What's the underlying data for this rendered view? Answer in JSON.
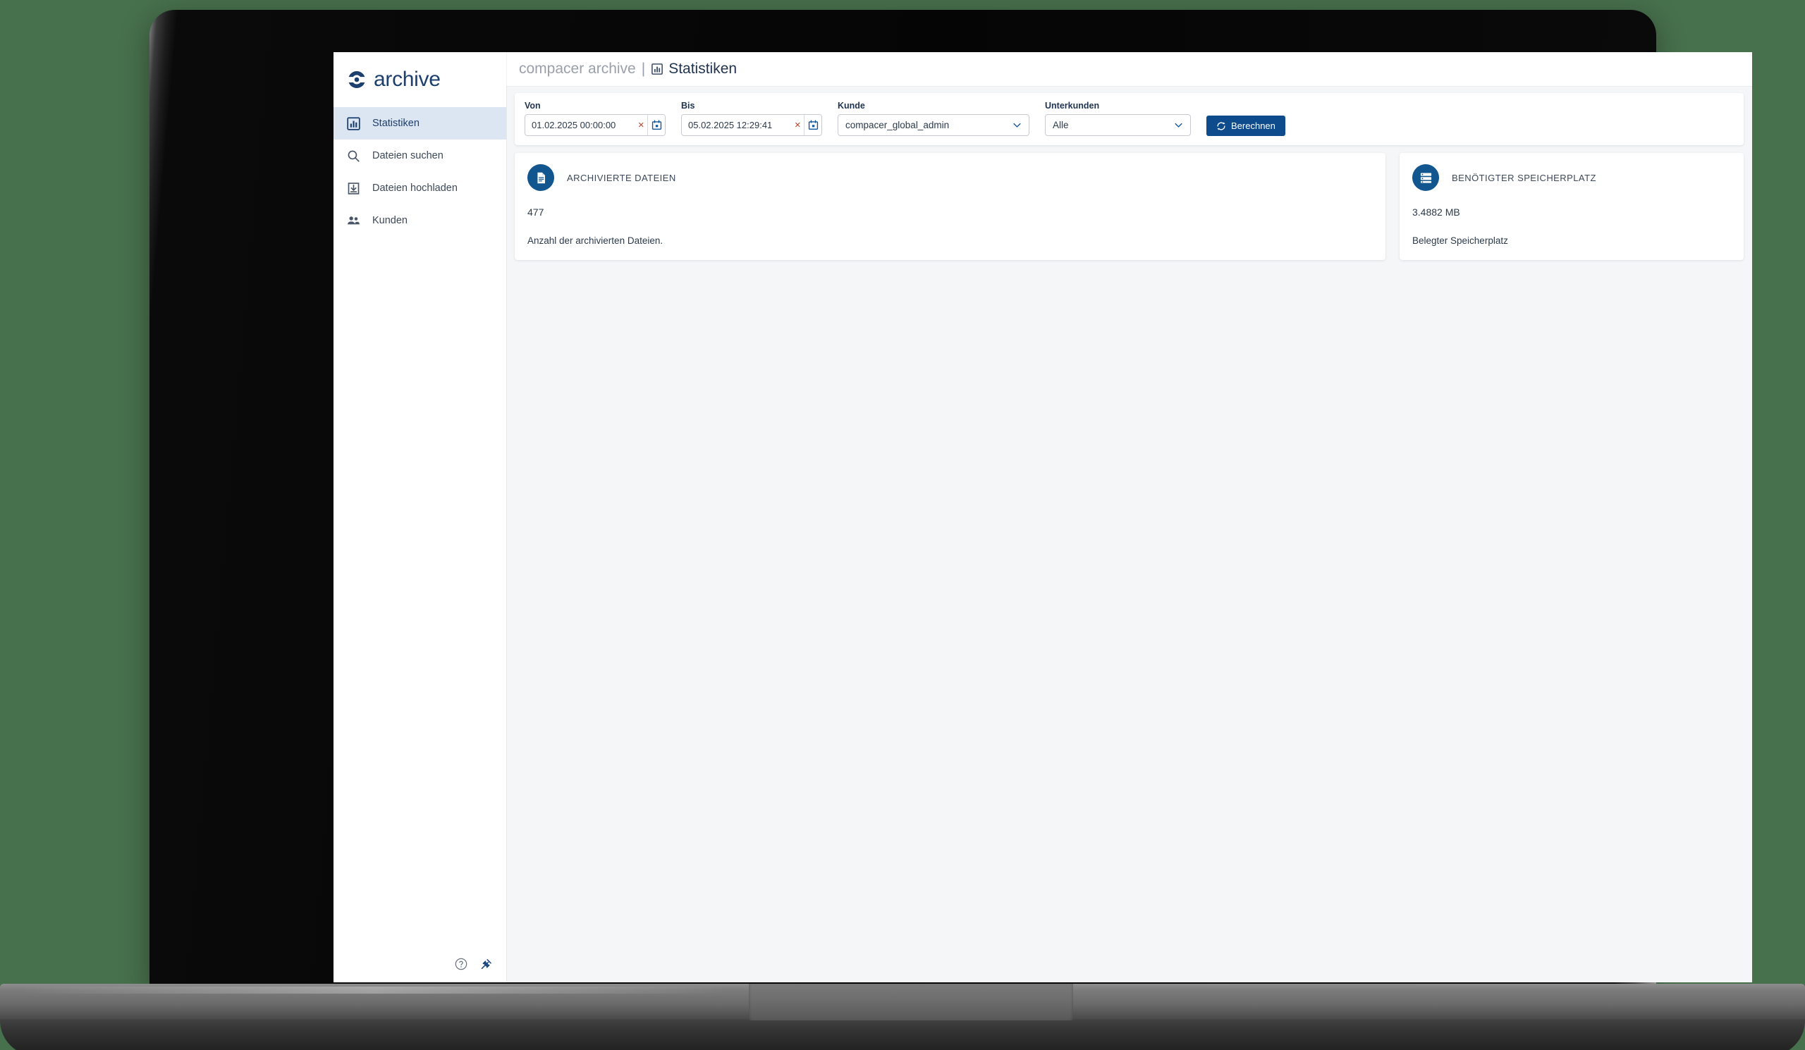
{
  "brand": {
    "name": "archive",
    "logo_icon": "archive-circle-logo"
  },
  "sidebar": {
    "items": [
      {
        "label": "Statistiken",
        "icon": "bar-chart-icon",
        "active": true
      },
      {
        "label": "Dateien suchen",
        "icon": "search-icon",
        "active": false
      },
      {
        "label": "Dateien hochladen",
        "icon": "download-box-icon",
        "active": false
      },
      {
        "label": "Kunden",
        "icon": "people-icon",
        "active": false
      }
    ],
    "footer": {
      "help_icon": "help-circle-icon",
      "pin_icon": "pin-icon"
    }
  },
  "topbar": {
    "app_name": "compacer archive",
    "separator": "|",
    "page_icon": "bar-chart-icon",
    "page_title": "Statistiken"
  },
  "filters": {
    "von": {
      "label": "Von",
      "value": "01.02.2025 00:00:00",
      "placeholder": "TT.MM.JJJJ hh:mm:ss",
      "clear_glyph": "×",
      "calendar_icon": "calendar-icon"
    },
    "bis": {
      "label": "Bis",
      "value": "05.02.2025 12:29:41",
      "placeholder": "TT.MM.JJJJ hh:mm:ss",
      "clear_glyph": "×",
      "calendar_icon": "calendar-icon"
    },
    "kunde": {
      "label": "Kunde",
      "value": "compacer_global_admin",
      "arrow_icon": "chevron-down-icon"
    },
    "unterkunden": {
      "label": "Unterkunden",
      "value": "Alle",
      "arrow_icon": "chevron-down-icon"
    },
    "calculate_button": {
      "label": "Berechnen",
      "icon": "refresh-icon"
    }
  },
  "cards": [
    {
      "title": "ARCHIVIERTE DATEIEN",
      "value": "477",
      "description": "Anzahl der archivierten Dateien.",
      "icon": "document-icon"
    },
    {
      "title": "BENÖTIGTER SPEICHERPLATZ",
      "value": "3.4882 MB",
      "description": "Belegter Speicherplatz",
      "icon": "storage-list-icon"
    }
  ],
  "colors": {
    "brand_navy": "#1c3f6e",
    "accent_blue": "#0e4b8c",
    "badge_blue": "#11568f",
    "active_nav_bg": "#dbe6f2",
    "content_bg": "#f4f6f8",
    "clear_red": "#b8432c",
    "desktop_bg": "#47704c"
  }
}
